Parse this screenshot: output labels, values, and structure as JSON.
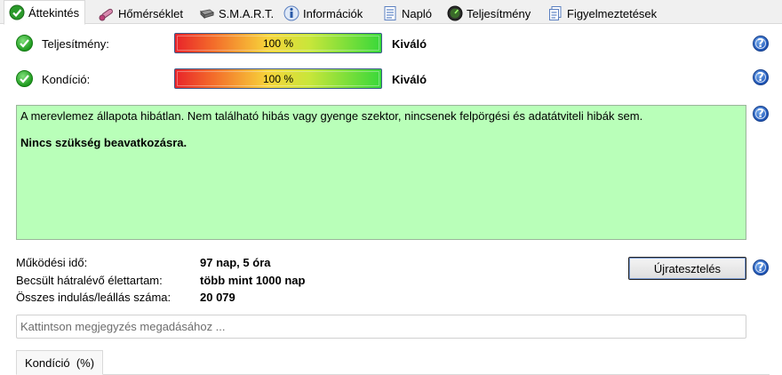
{
  "tabs": [
    {
      "label": "Áttekintés",
      "icon": "check-circle-icon",
      "active": true
    },
    {
      "label": "Hőmérséklet",
      "icon": "thermometer-icon",
      "active": false
    },
    {
      "label": "S.M.A.R.T.",
      "icon": "drive-icon",
      "active": false
    },
    {
      "label": "Információk",
      "icon": "info-icon",
      "active": false
    },
    {
      "label": "Napló",
      "icon": "log-document-icon",
      "active": false
    },
    {
      "label": "Teljesítmény",
      "icon": "performance-icon",
      "active": false
    },
    {
      "label": "Figyelmeztetések",
      "icon": "warnings-document-icon",
      "active": false
    }
  ],
  "performance": {
    "label": "Teljesítmény:",
    "percent_text": "100 %",
    "percent": 100,
    "status": "Kiváló"
  },
  "condition": {
    "label": "Kondíció:",
    "percent_text": "100 %",
    "percent": 100,
    "status": "Kiváló"
  },
  "description": {
    "text": "A merevlemez állapota hibátlan. Nem található hibás vagy gyenge szektor, nincsenek felpörgési és adatátviteli hibák sem.",
    "recommendation": "Nincs szükség beavatkozásra."
  },
  "info": {
    "uptime_label": "Működési idő:",
    "uptime_value": "97 nap, 5 óra",
    "lifetime_label": "Becsült hátralévő élettartam:",
    "lifetime_value": "több mint 1000 nap",
    "starts_label": "Összes indulás/leállás száma:",
    "starts_value": "20 079"
  },
  "retest_button": "Újratesztelés",
  "note": {
    "placeholder": "Kattintson megjegyzés megadásához ...",
    "value": ""
  },
  "bottom_tab": {
    "label": "Kondíció  (%)"
  },
  "help_icon_text": "?",
  "colors": {
    "description_bg": "#b9ffb9",
    "help_blue": "#1f56b8",
    "check_green": "#1f9a1f"
  }
}
